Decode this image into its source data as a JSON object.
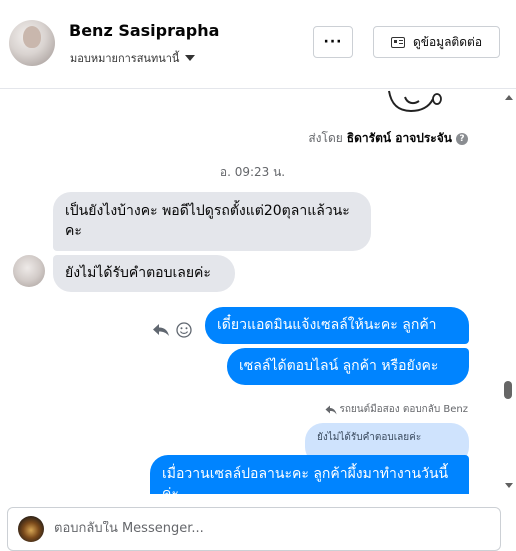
{
  "header": {
    "contact_name": "Benz Sasiprapha",
    "assign_label": "มอบหมายการสนทนานี้",
    "more_label": "···",
    "info_button_label": "ดูข้อมูลติดต่อ"
  },
  "thread": {
    "sent_by_prefix": "ส่งโดย",
    "sent_by_name": "ธิดารัตน์ อาจประจัน",
    "help_icon_glyph": "?",
    "timestamp": "อ. 09:23 น.",
    "messages": [
      {
        "direction": "in",
        "text": "เป็นยังไงบ้างคะ พอดีไปดูรถตั้งแต่20ตุลาแล้วนะคะ"
      },
      {
        "direction": "in",
        "text": "ยังไม่ได้รับคำตอบเลยค่ะ"
      },
      {
        "direction": "out",
        "text": "เดี๋ยวแอดมินแจ้งเซลล์ให้นะคะ  ลูกค้า"
      },
      {
        "direction": "out",
        "text": "เซลล์ได้ตอบไลน์ ลูกค้า หรือยังคะ"
      },
      {
        "direction": "out",
        "text": "เมื่อวานเซลล์ปอลานะคะ  ลูกค้าผึ้งมาทำงานวันนี้ค่ะ"
      }
    ],
    "reply_label": "รถยนต์มือสอง ตอบกลับ Benz",
    "quoted_text": "ยังไม่ได้รับคำตอบเลยค่ะ"
  },
  "composer": {
    "placeholder": "ตอบกลับใน Messenger..."
  },
  "colors": {
    "outgoing_bubble": "#0084ff",
    "incoming_bubble": "#e4e6eb",
    "quoted_bubble": "#cfe3fd"
  }
}
